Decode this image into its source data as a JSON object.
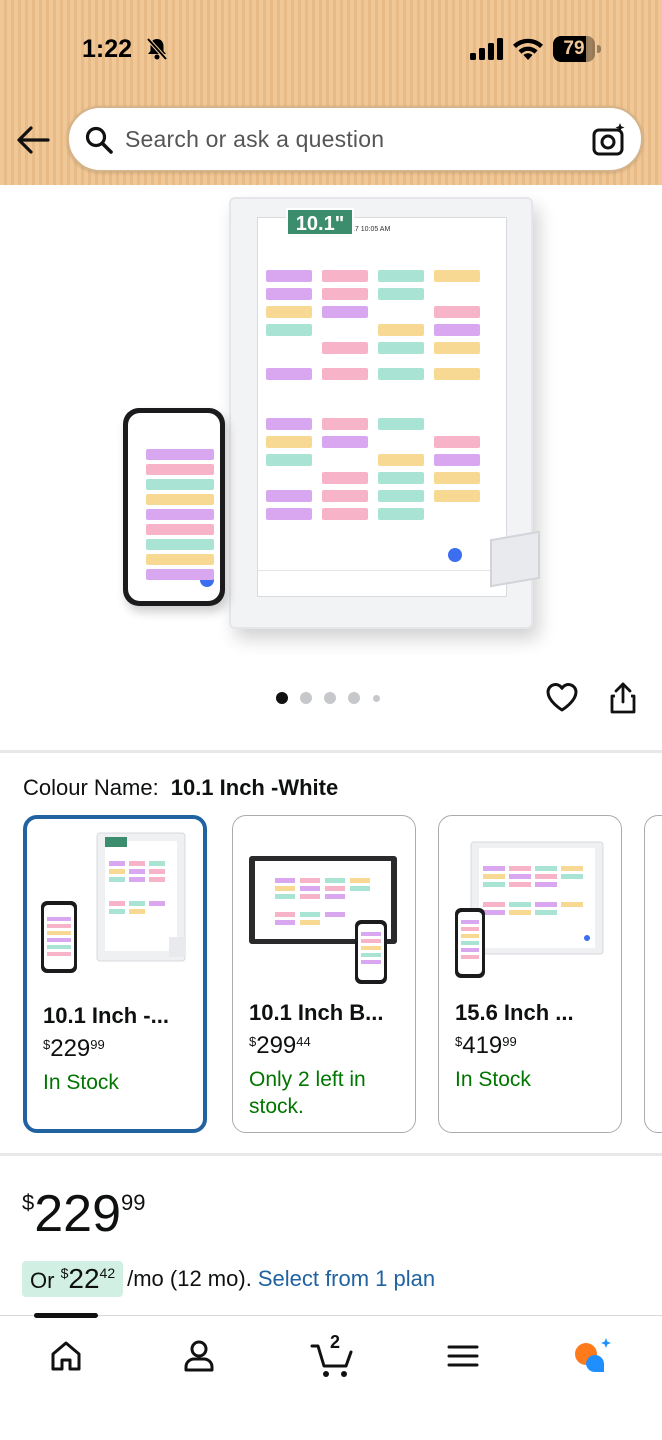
{
  "status_bar": {
    "time": "1:22",
    "battery": "79",
    "battery_level": 0.79
  },
  "search": {
    "placeholder": "Search or ask a question"
  },
  "gallery": {
    "size_badge": "10.1\"",
    "screen_header": "72°F  September 17  10:05 AM",
    "image_count": 5,
    "active_index": 0
  },
  "colour": {
    "label": "Colour Name:",
    "value": "10.1 Inch -White"
  },
  "variants": [
    {
      "name": "10.1 Inch -...",
      "price_whole": "229",
      "price_fraction": "99",
      "stock": "In Stock",
      "selected": true
    },
    {
      "name": "10.1 Inch B...",
      "price_whole": "299",
      "price_fraction": "44",
      "stock": "Only 2 left in stock.",
      "selected": false
    },
    {
      "name": "15.6 Inch ...",
      "price_whole": "419",
      "price_fraction": "99",
      "stock": "In Stock",
      "selected": false
    }
  ],
  "price": {
    "symbol": "$",
    "whole": "229",
    "fraction": "99"
  },
  "monthly": {
    "prefix": "Or",
    "symbol": "$",
    "whole": "22",
    "fraction": "42",
    "suffix": "/mo (12 mo).",
    "link": "Select from 1 plan"
  },
  "bottom_nav": {
    "cart_count": "2"
  }
}
